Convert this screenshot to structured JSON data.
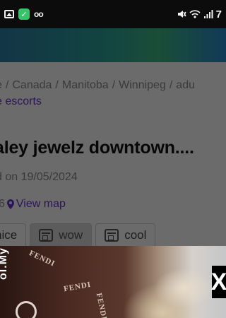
{
  "status_bar": {
    "left_icons": [
      "gallery-icon",
      "app-icon",
      "voicemail-icon"
    ],
    "right_icons": [
      "mute-icon",
      "wifi-icon",
      "signal-icon"
    ],
    "time": "7"
  },
  "breadcrumb": {
    "items": [
      "e",
      "Canada",
      "Manitoba",
      "Winnipeg",
      "adu"
    ]
  },
  "category_link": "e escorts",
  "listing": {
    "title": "aley jewelz downtown....",
    "posted": "d on 19/05/2024",
    "id_fragment": "6",
    "view_map": "View map"
  },
  "reactions": [
    {
      "label": "nice",
      "active": false
    },
    {
      "label": "wow",
      "active": true
    },
    {
      "label": "cool",
      "active": false
    }
  ],
  "ad": {
    "watermark": "ol.My",
    "brand_text": "FENDI",
    "close_label": "X"
  },
  "colors": {
    "link": "#6633cc",
    "status_bar_bg": "#0c0c0c",
    "overlay": "rgba(0,0,0,0.58)"
  }
}
